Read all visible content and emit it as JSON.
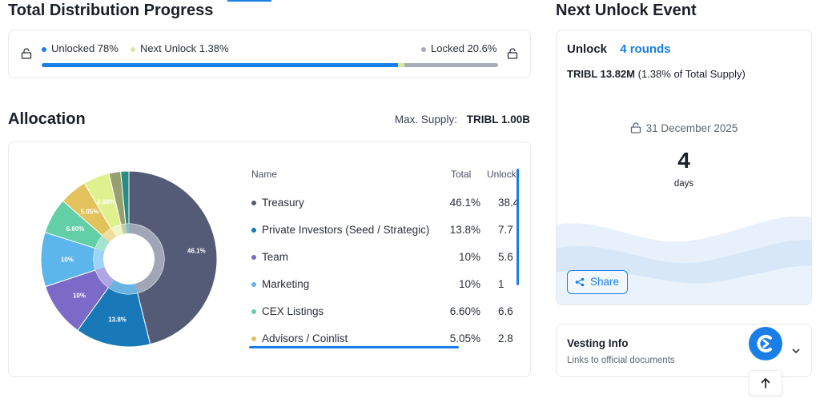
{
  "distribution": {
    "title": "Total Distribution Progress",
    "legend": [
      {
        "label": "Unlocked 78%",
        "color": "#1a7ee8"
      },
      {
        "label": "Next Unlock 1.38%",
        "color": "#d7e8a0"
      },
      {
        "label": "Locked 20.6%",
        "color": "#a7adb8"
      }
    ],
    "progress": {
      "unlocked": 0.78,
      "next_unlock": 0.0138,
      "locked": 0.206
    }
  },
  "allocation": {
    "title": "Allocation",
    "max_supply_label": "Max. Supply:",
    "max_supply_value": "TRIBL 1.00B",
    "table": {
      "headers": {
        "name": "Name",
        "total": "Total",
        "unlock": "Unlock"
      },
      "rows": [
        {
          "name": "Treasury",
          "total": "46.1%",
          "unlock": "38.4",
          "color": "#545b76"
        },
        {
          "name": "Private Investors (Seed / Strategic)",
          "total": "13.8%",
          "unlock": "7.7",
          "color": "#1978b7"
        },
        {
          "name": "Team",
          "total": "10%",
          "unlock": "5.6",
          "color": "#7b6ac8"
        },
        {
          "name": "Marketing",
          "total": "10%",
          "unlock": "1",
          "color": "#5cb6ec"
        },
        {
          "name": "CEX Listings",
          "total": "6.60%",
          "unlock": "6.6",
          "color": "#62cfa7"
        },
        {
          "name": "Advisors / Coinlist",
          "total": "5.05%",
          "unlock": "2.8",
          "color": "#e2c25a"
        }
      ]
    }
  },
  "chart_data": {
    "type": "pie",
    "values": [
      46.1,
      13.8,
      10,
      10,
      6.6,
      5.05,
      4.8,
      2.15,
      1.5
    ],
    "labels": [
      "46.1%",
      "13.8%",
      "10%",
      "10%",
      "6.60%",
      "5.05%",
      "4.80%",
      "",
      ""
    ],
    "colors": [
      "#545b76",
      "#1978b7",
      "#7b6ac8",
      "#5cb6ec",
      "#62cfa7",
      "#e2c25a",
      "#dff08e",
      "#99a070",
      "#2a8c86"
    ],
    "inner_colors": [
      "#a0a6b7",
      "#6ab3e1",
      "#b0a6e1",
      "#9ed4f5",
      "#a6e4cd",
      "#efdca0",
      "#eef6c4",
      "#c8cbb0",
      "#88c0bd"
    ]
  },
  "next_unlock": {
    "title": "Next Unlock Event",
    "unlock_label": "Unlock",
    "rounds": "4 rounds",
    "amount": "TRIBL 13.82M",
    "amount_note": "(1.38% of Total Supply)",
    "date": "31 December 2025",
    "countdown_value": "4",
    "countdown_unit": "days",
    "share_label": "Share"
  },
  "vesting": {
    "title": "Vesting Info",
    "subtitle": "Links to official documents"
  },
  "colors": {
    "accent": "#1a7ee8",
    "text": "#1b1f29"
  }
}
